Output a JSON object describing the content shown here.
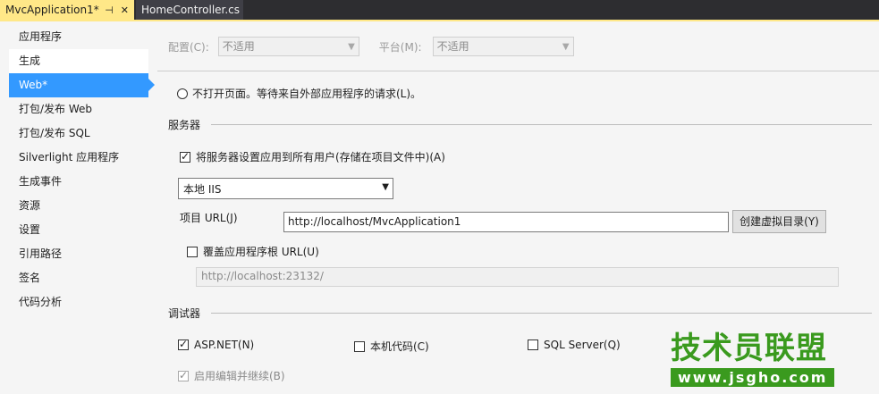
{
  "tabs": {
    "active_label": "MvcApplication1*",
    "pin_icon": "pin-icon",
    "close_icon": "close-icon",
    "other_label": "HomeController.cs"
  },
  "sidebar": {
    "items": [
      {
        "label": "应用程序"
      },
      {
        "label": "生成"
      },
      {
        "label": "Web*"
      },
      {
        "label": "打包/发布 Web"
      },
      {
        "label": "打包/发布 SQL"
      },
      {
        "label": "Silverlight 应用程序"
      },
      {
        "label": "生成事件"
      },
      {
        "label": "资源"
      },
      {
        "label": "设置"
      },
      {
        "label": "引用路径"
      },
      {
        "label": "签名"
      },
      {
        "label": "代码分析"
      }
    ]
  },
  "config": {
    "config_label": "配置(C):",
    "config_value": "不适用",
    "platform_label": "平台(M):",
    "platform_value": "不适用"
  },
  "start": {
    "radio_label": "不打开页面。等待来自外部应用程序的请求(L)。"
  },
  "servers": {
    "title": "服务器",
    "apply_all_label": "将服务器设置应用到所有用户(存储在项目文件中)(A)",
    "server_value": "本地 IIS",
    "project_url_label": "项目 URL(J)",
    "project_url_value": "http://localhost/MvcApplication1",
    "create_vdir_label": "创建虚拟目录(Y)",
    "override_root_label": "覆盖应用程序根 URL(U)",
    "override_root_value": "http://localhost:23132/"
  },
  "debuggers": {
    "title": "调试器",
    "aspnet_label": "ASP.NET(N)",
    "native_label": "本机代码(C)",
    "sql_label": "SQL Server(Q)",
    "edit_continue_label": "启用编辑并继续(B)"
  },
  "watermark": {
    "brand": "技术员联盟",
    "url": "www.jsgho.com"
  }
}
